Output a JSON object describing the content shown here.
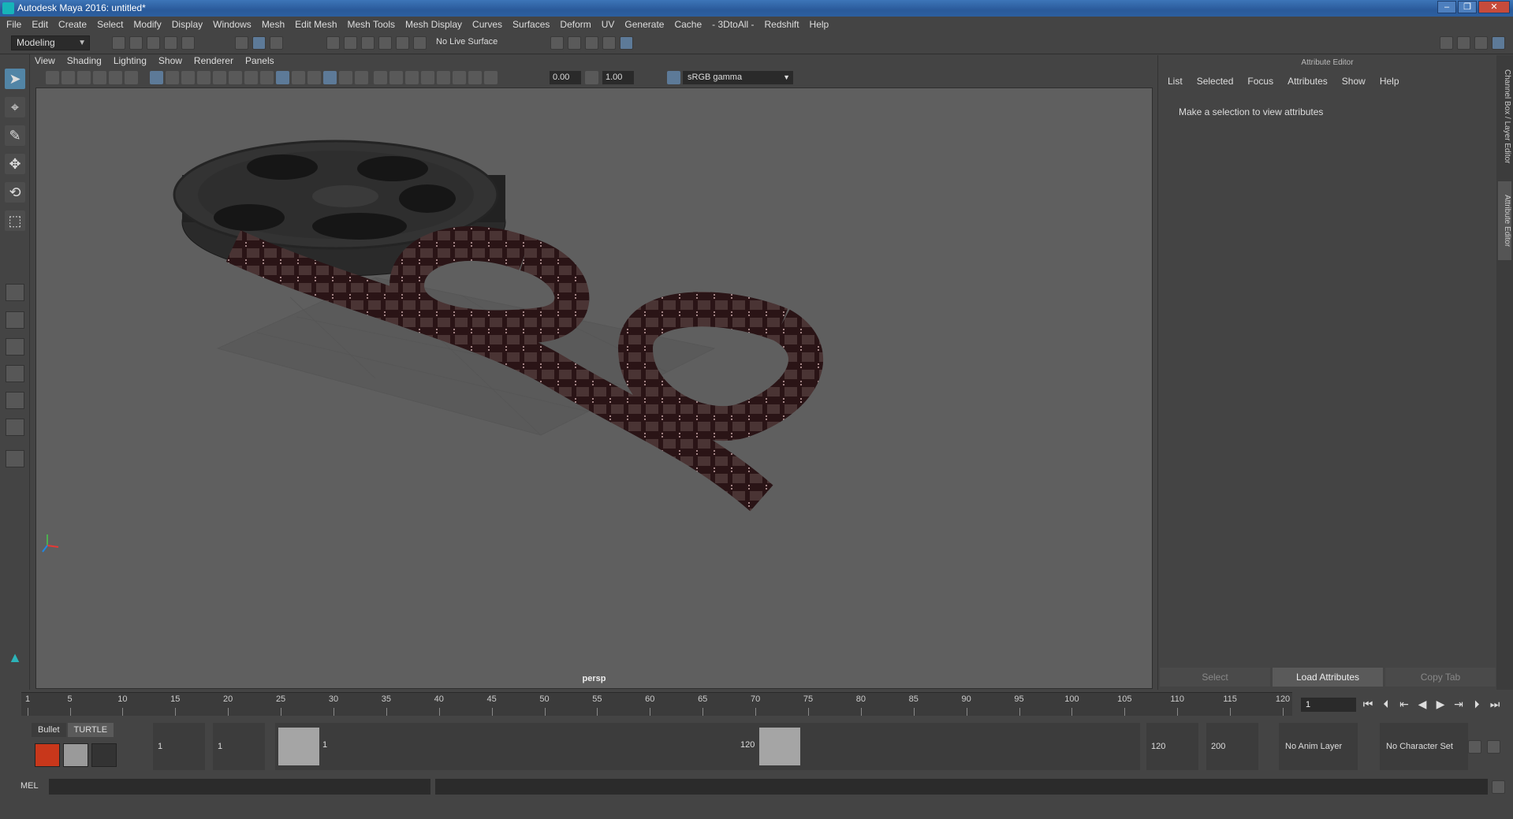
{
  "window": {
    "title": "Autodesk Maya 2016: untitled*"
  },
  "menubar": [
    "File",
    "Edit",
    "Create",
    "Select",
    "Modify",
    "Display",
    "Windows",
    "Mesh",
    "Edit Mesh",
    "Mesh Tools",
    "Mesh Display",
    "Curves",
    "Surfaces",
    "Deform",
    "UV",
    "Generate",
    "Cache",
    "- 3DtoAll -",
    "Redshift",
    "Help"
  ],
  "status_line": {
    "mode": "Modeling",
    "live_surface": "No Live Surface"
  },
  "panel": {
    "menu": [
      "View",
      "Shading",
      "Lighting",
      "Show",
      "Renderer",
      "Panels"
    ],
    "exposure": "0.00",
    "gamma": "1.00",
    "color_space": "sRGB gamma",
    "camera_label": "persp"
  },
  "attribute_editor": {
    "title": "Attribute Editor",
    "menu": [
      "List",
      "Selected",
      "Focus",
      "Attributes",
      "Show",
      "Help"
    ],
    "message": "Make a selection to view attributes",
    "buttons": {
      "select": "Select",
      "load": "Load Attributes",
      "copy": "Copy Tab"
    },
    "side_tabs": {
      "channel_box": "Channel Box / Layer Editor",
      "attr_editor": "Attribute Editor"
    }
  },
  "timeline": {
    "ticks": [
      "1",
      "5",
      "10",
      "15",
      "20",
      "25",
      "30",
      "35",
      "40",
      "45",
      "50",
      "55",
      "60",
      "65",
      "70",
      "75",
      "80",
      "85",
      "90",
      "95",
      "100",
      "105",
      "110",
      "115",
      "120"
    ],
    "current_frame": "1"
  },
  "range": {
    "shelf_tabs": [
      "Bullet",
      "TURTLE"
    ],
    "start_a": "1",
    "start_b": "1",
    "slider_start": "1",
    "slider_end": "120",
    "end_a": "120",
    "end_b": "200",
    "anim_layer": "No Anim Layer",
    "char_set": "No Character Set"
  },
  "command_line": {
    "label": "MEL"
  },
  "colors": {
    "viewport_bg": "#5f5f5f",
    "film": "#2a1416",
    "reel": "#2c2c2c",
    "accent": "#5285a6"
  }
}
